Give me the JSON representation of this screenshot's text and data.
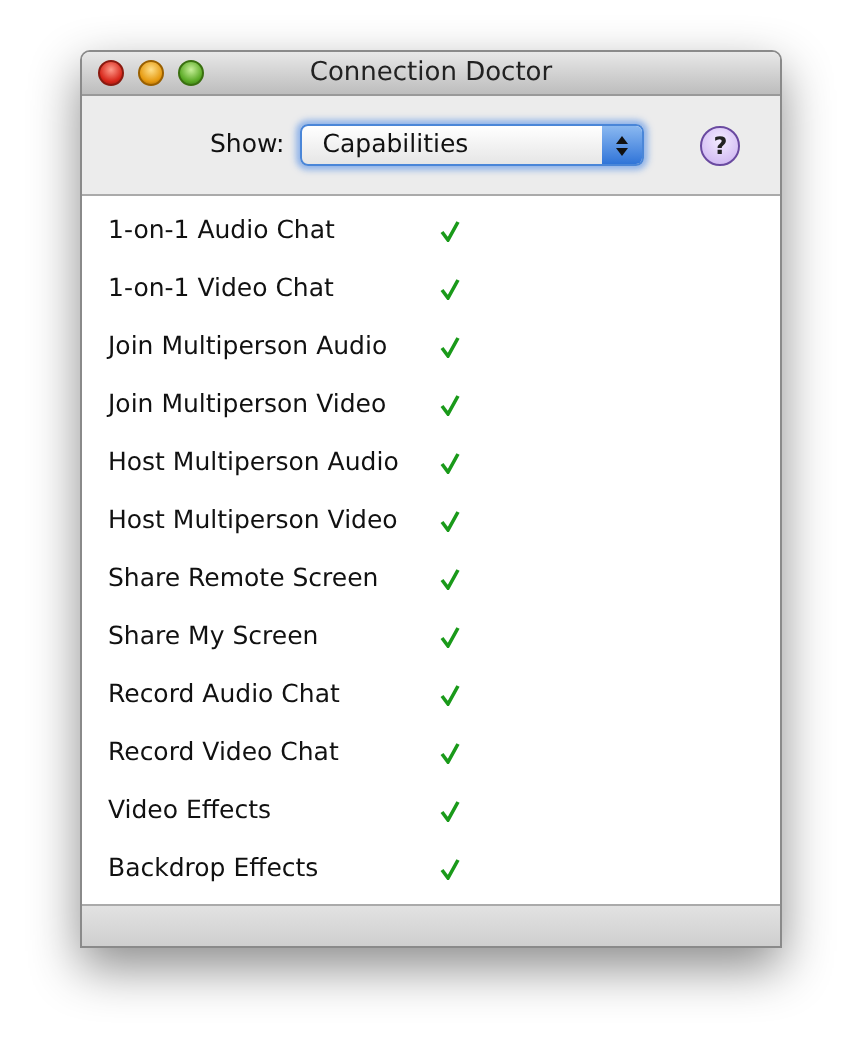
{
  "window": {
    "title": "Connection Doctor"
  },
  "toolbar": {
    "show_label": "Show:",
    "show_value": "Capabilities",
    "help": "?"
  },
  "capabilities": [
    {
      "name": "1-on-1 Audio Chat",
      "supported": true
    },
    {
      "name": "1-on-1 Video Chat",
      "supported": true
    },
    {
      "name": "Join Multiperson Audio",
      "supported": true
    },
    {
      "name": "Join Multiperson Video",
      "supported": true
    },
    {
      "name": "Host Multiperson Audio",
      "supported": true
    },
    {
      "name": "Host Multiperson Video",
      "supported": true
    },
    {
      "name": "Share Remote Screen",
      "supported": true
    },
    {
      "name": "Share My Screen",
      "supported": true
    },
    {
      "name": "Record Audio Chat",
      "supported": true
    },
    {
      "name": "Record Video Chat",
      "supported": true
    },
    {
      "name": "Video Effects",
      "supported": true
    },
    {
      "name": "Backdrop Effects",
      "supported": true
    }
  ]
}
